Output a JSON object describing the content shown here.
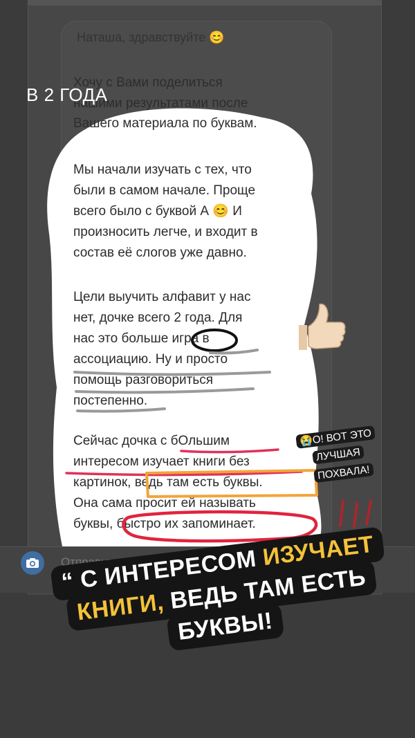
{
  "story": {
    "label": "В 2 ГОДА"
  },
  "message": {
    "greeting": "Наташа, здравствуйте 😊",
    "lines": [
      "Хочу с Вами поделиться",
      "нашими результатами после",
      "Вашего материала по буквам.",
      "",
      "Мы начали изучать с тех, что",
      "были в самом начале. Проще",
      "всего было с буквой А 😊 И",
      "произносить легче, и входит в",
      "состав её слогов уже давно.",
      "",
      "Цели выучить алфавит у нас",
      "нет, дочке всего 2 года. Для",
      "нас это больше игра в",
      "ассоциацию. Ну и просто",
      "помощь разговориться",
      "постепенно.",
      "",
      "Сейчас дочка с бОльшим",
      "интересом изучает книги без",
      "картинок, ведь там есть буквы.",
      "Она сама просит ей называть",
      "буквы, быстро их запоминает."
    ]
  },
  "reaction": {
    "line1": "😭О! ВОТ ЭТО",
    "line2": "ЛУЧШАЯ",
    "line3": "ПОХВАЛА!"
  },
  "composer": {
    "placeholder": "Отправьте сообщение..."
  },
  "quote": {
    "line1_white": "“ С ИНТЕРЕСОМ ",
    "line1_yellow": "ИЗУЧАЕТ",
    "line2_yellow": "КНИГИ, ",
    "line2_white": "ВЕДЬ ТАМ ЕСТЬ",
    "line3_white": "БУКВЫ!"
  },
  "colors": {
    "dim_background": "#3b3b3b",
    "cutout": "#ffffff",
    "quote_accent": "#f4c23a",
    "highlight_pink": "#e0315a",
    "highlight_orange": "#f2a43a",
    "underline_gray": "#9a9a9a",
    "camera_button": "#3f6ea3"
  },
  "icons": {
    "camera": "camera-icon",
    "thumbs_up": "thumbs-up-icon",
    "crying_face": "crying-face-icon"
  }
}
